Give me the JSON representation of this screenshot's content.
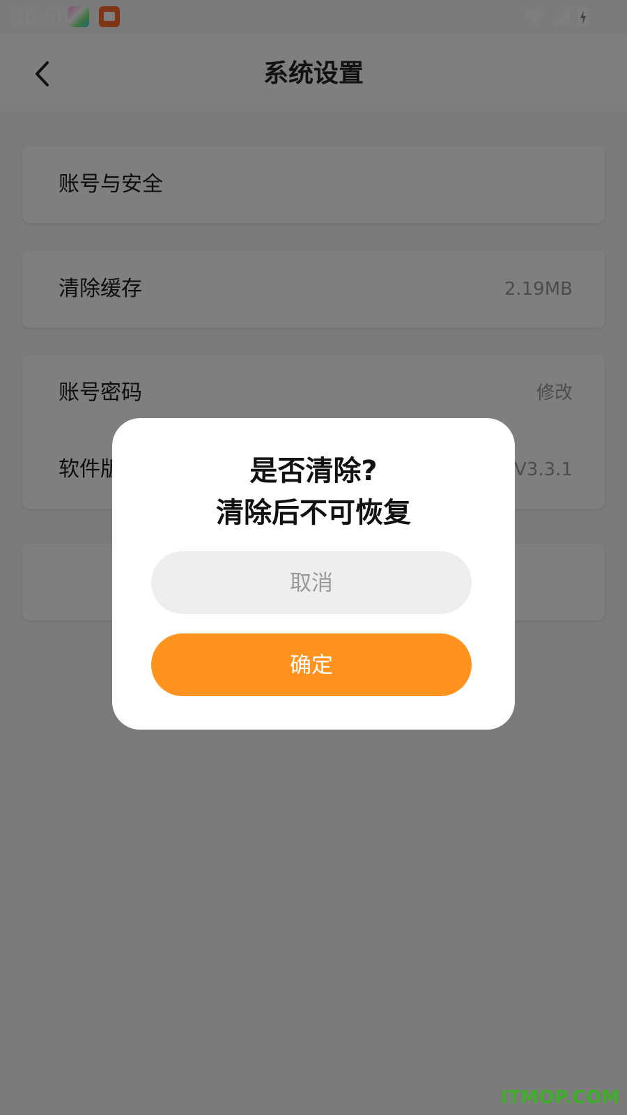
{
  "status_bar": {
    "time": "10:56",
    "icons": [
      "app-photo-icon",
      "app-book-icon",
      "wifi-icon",
      "signal-icon",
      "battery-charging-icon"
    ]
  },
  "header": {
    "title": "系统设置",
    "back_icon": "chevron-left-icon"
  },
  "settings": {
    "account_security": {
      "label": "账号与安全"
    },
    "clear_cache": {
      "label": "清除缓存",
      "value": "2.19MB"
    },
    "account_password": {
      "label": "账号密码",
      "value": "修改"
    },
    "software_version": {
      "label": "软件版本",
      "value": "版本号: V3.3.1"
    }
  },
  "dialog": {
    "title": "是否清除?",
    "message": "清除后不可恢复",
    "cancel_label": "取消",
    "confirm_label": "确定"
  },
  "watermark": "ITMOP.COM",
  "colors": {
    "accent": "#ff931e",
    "overlay": "#000000",
    "cancel_bg": "#eeeeee",
    "watermark": "#3fae2a"
  }
}
